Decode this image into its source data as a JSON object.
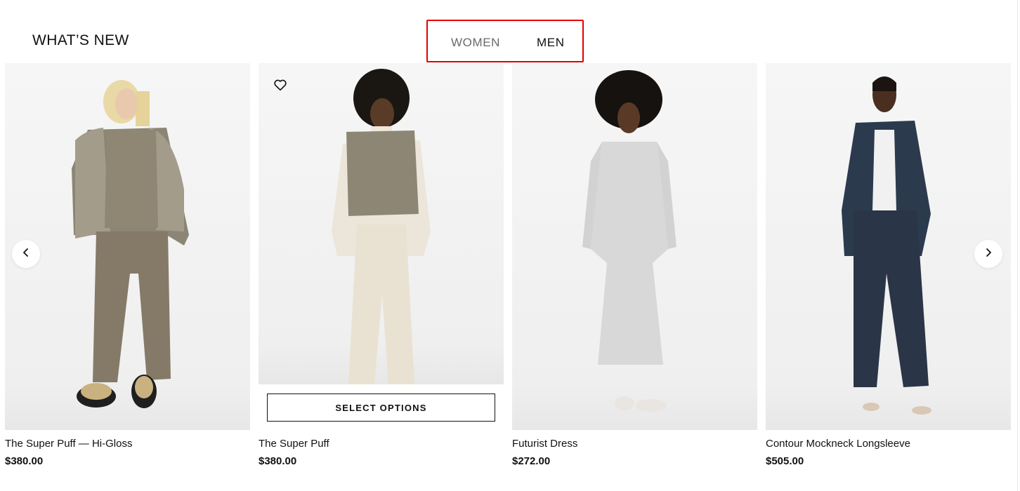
{
  "section": {
    "title": "WHAT’S NEW"
  },
  "tabs": [
    {
      "label": "WOMEN",
      "active": false
    },
    {
      "label": "MEN",
      "active": true
    }
  ],
  "highlight_color": "#e30000",
  "products": [
    {
      "name": "The Super Puff — Hi-Gloss",
      "price": "$380.00",
      "image": "model-in-glossy-taupe-puffer-jacket-and-sweatpants"
    },
    {
      "name": "The Super Puff",
      "price": "$380.00",
      "image": "model-in-taupe-puffer-vest-and-cream-trousers",
      "wishlist_icon": "heart-outline-icon",
      "action_label": "SELECT OPTIONS"
    },
    {
      "name": "Futurist Dress",
      "price": "$272.00",
      "image": "model-in-light-grey-long-sleeve-midi-dress"
    },
    {
      "name": "Contour Mockneck Longsleeve",
      "price": "$505.00",
      "image": "model-in-navy-blazer-and-trousers"
    }
  ],
  "carousel": {
    "prev_icon": "chevron-left-icon",
    "next_icon": "chevron-right-icon"
  }
}
